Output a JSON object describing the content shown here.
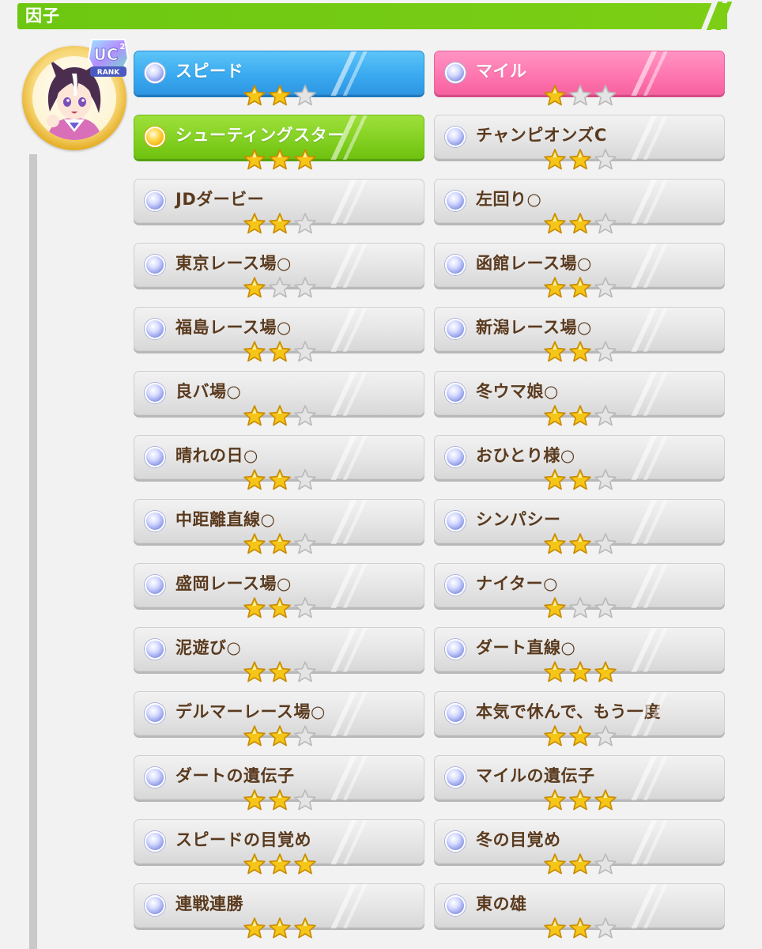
{
  "header": {
    "title": "因子"
  },
  "character": {
    "rank": "RANK",
    "rank_code": "UC",
    "rank_sup": "2"
  },
  "factors": [
    {
      "label": "スピード",
      "stars": 2,
      "style": "blue",
      "dot": "blue"
    },
    {
      "label": "マイル",
      "stars": 1,
      "style": "pink",
      "dot": "blue"
    },
    {
      "label": "シューティングスター",
      "stars": 3,
      "style": "green",
      "dot": "gold"
    },
    {
      "label": "チャンピオンズC",
      "stars": 2,
      "style": "white",
      "dot": "blue"
    },
    {
      "label": "JDダービー",
      "stars": 2,
      "style": "white",
      "dot": "blue"
    },
    {
      "label": "左回り○",
      "stars": 2,
      "style": "white",
      "dot": "blue"
    },
    {
      "label": "東京レース場○",
      "stars": 1,
      "style": "white",
      "dot": "blue"
    },
    {
      "label": "函館レース場○",
      "stars": 2,
      "style": "white",
      "dot": "blue"
    },
    {
      "label": "福島レース場○",
      "stars": 2,
      "style": "white",
      "dot": "blue"
    },
    {
      "label": "新潟レース場○",
      "stars": 2,
      "style": "white",
      "dot": "blue"
    },
    {
      "label": "良バ場○",
      "stars": 2,
      "style": "white",
      "dot": "blue"
    },
    {
      "label": "冬ウマ娘○",
      "stars": 2,
      "style": "white",
      "dot": "blue"
    },
    {
      "label": "晴れの日○",
      "stars": 2,
      "style": "white",
      "dot": "blue"
    },
    {
      "label": "おひとり様○",
      "stars": 2,
      "style": "white",
      "dot": "blue"
    },
    {
      "label": "中距離直線○",
      "stars": 2,
      "style": "white",
      "dot": "blue"
    },
    {
      "label": "シンパシー",
      "stars": 2,
      "style": "white",
      "dot": "blue"
    },
    {
      "label": "盛岡レース場○",
      "stars": 2,
      "style": "white",
      "dot": "blue"
    },
    {
      "label": "ナイター○",
      "stars": 1,
      "style": "white",
      "dot": "blue"
    },
    {
      "label": "泥遊び○",
      "stars": 2,
      "style": "white",
      "dot": "blue"
    },
    {
      "label": "ダート直線○",
      "stars": 3,
      "style": "white",
      "dot": "blue"
    },
    {
      "label": "デルマーレース場○",
      "stars": 2,
      "style": "white",
      "dot": "blue"
    },
    {
      "label": "本気で休んで、もう一度",
      "stars": 2,
      "style": "white",
      "dot": "blue"
    },
    {
      "label": "ダートの遺伝子",
      "stars": 2,
      "style": "white",
      "dot": "blue"
    },
    {
      "label": "マイルの遺伝子",
      "stars": 3,
      "style": "white",
      "dot": "blue"
    },
    {
      "label": "スピードの目覚め",
      "stars": 3,
      "style": "white",
      "dot": "blue"
    },
    {
      "label": "冬の目覚め",
      "stars": 2,
      "style": "white",
      "dot": "blue"
    },
    {
      "label": "連戦連勝",
      "stars": 3,
      "style": "white",
      "dot": "blue"
    },
    {
      "label": "東の雄",
      "stars": 2,
      "style": "white",
      "dot": "blue"
    }
  ],
  "colors": {
    "header_green": "#7ccf15",
    "label_brown": "#5a3a1e",
    "star_filled": "#f5c518",
    "star_empty": "#e4e4e4"
  },
  "icons": {
    "filled_star": "star-filled-icon",
    "empty_star": "star-empty-icon",
    "factor_dot": "factor-gem-icon"
  }
}
